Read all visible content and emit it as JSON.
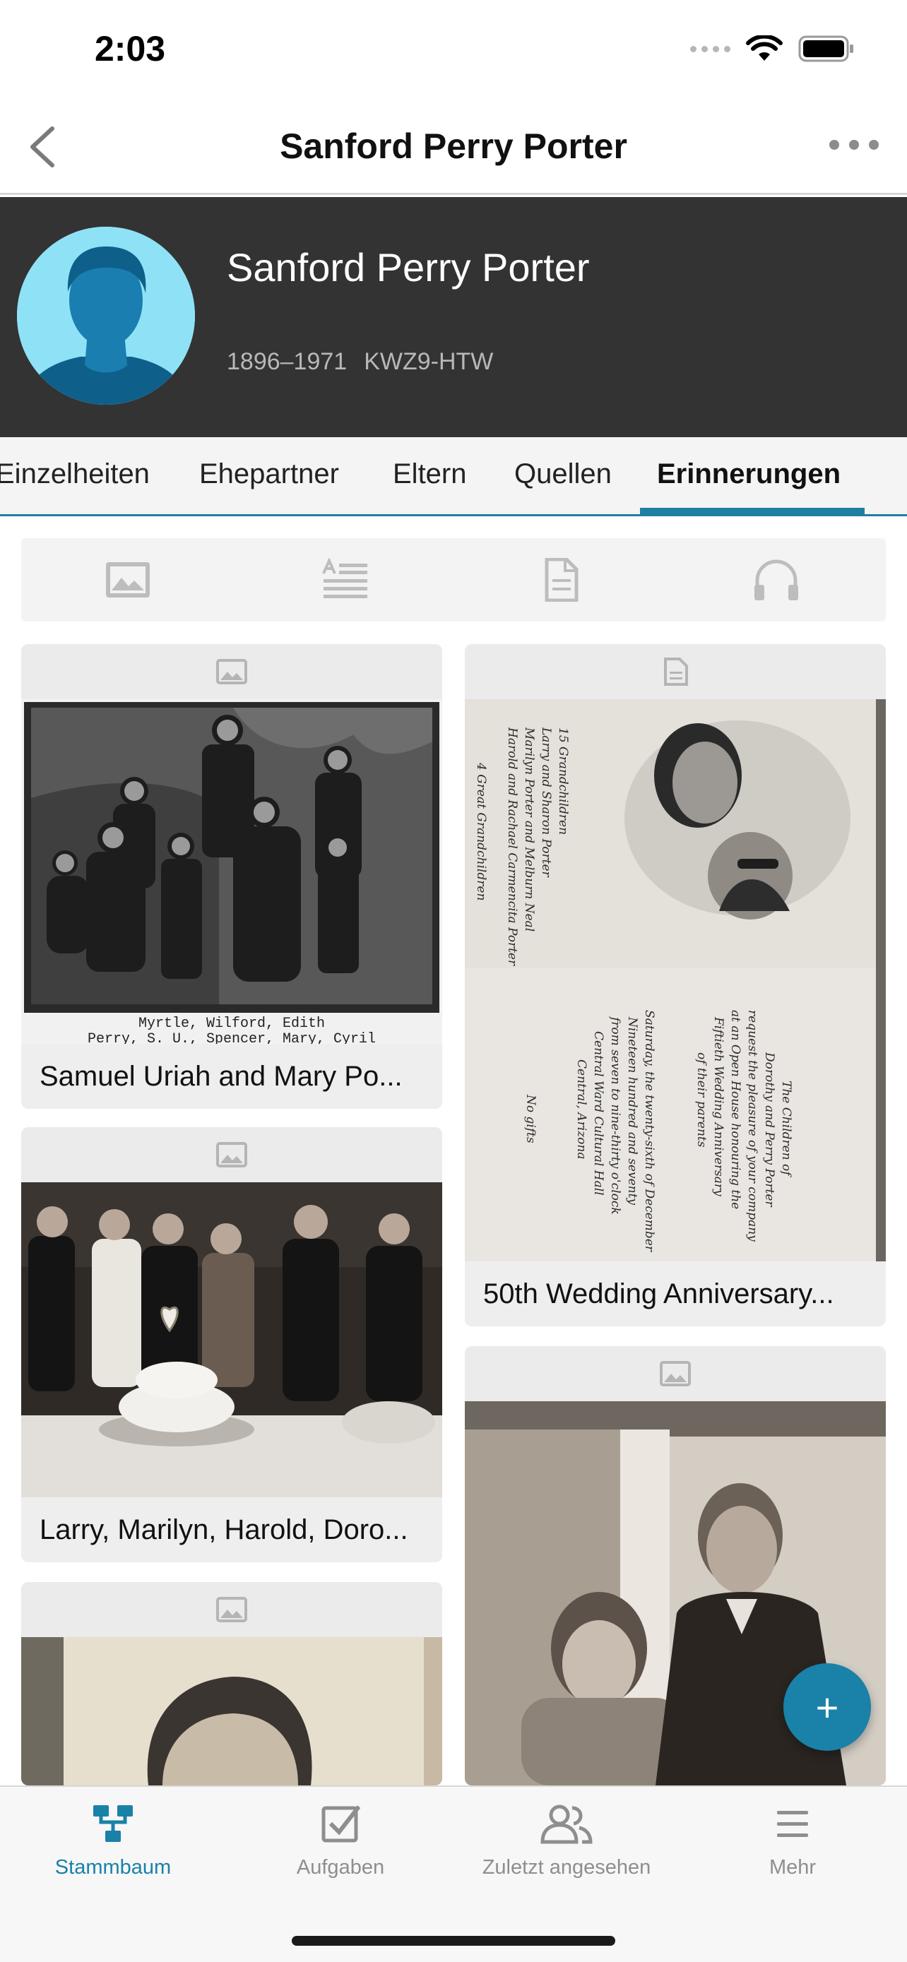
{
  "status_bar": {
    "time": "2:03"
  },
  "nav": {
    "title": "Sanford Perry Porter"
  },
  "person": {
    "name": "Sanford Perry Porter",
    "lifespan": "1896–1971",
    "id": "KWZ9-HTW"
  },
  "tabs": [
    {
      "label": "Einzelheiten"
    },
    {
      "label": "Ehepartner"
    },
    {
      "label": "Eltern"
    },
    {
      "label": "Quellen"
    },
    {
      "label": "Erinnerungen",
      "active": true
    }
  ],
  "filters": [
    {
      "icon": "photo-icon"
    },
    {
      "icon": "story-icon"
    },
    {
      "icon": "document-icon"
    },
    {
      "icon": "audio-icon"
    }
  ],
  "memories": [
    {
      "type_icon": "photo-icon",
      "caption": "Samuel Uriah and Mary Po...",
      "photo_text": [
        "Myrtle, Wilford, Edith",
        "Perry, S. U., Spencer, Mary, Cyril"
      ]
    },
    {
      "type_icon": "document-icon",
      "caption": "50th Wedding Anniversary...",
      "photo_text": [
        "Harold and Rachael Carmencita Porter",
        "Marilyn Porter and Melburn Neal",
        "Larry and Sharon Porter",
        "15 Grandchildren",
        "4 Great Grandchildren",
        "The Children of",
        "Dorothy and Perry Porter",
        "request the pleasure of your company",
        "at an Open House honouring the",
        "Fiftieth Wedding Anniversary",
        "of their parents",
        "Saturday, the twenty-sixth of December",
        "Nineteen hundred and seventy",
        "from seven to nine-thirty o'clock",
        "Central Ward Cultural Hall",
        "Central, Arizona",
        "No gifts"
      ]
    },
    {
      "type_icon": "photo-icon",
      "caption": "Larry, Marilyn, Harold, Doro..."
    },
    {
      "type_icon": "photo-icon",
      "caption": ""
    },
    {
      "type_icon": "photo-icon",
      "caption": ""
    }
  ],
  "fab": {
    "label": "+"
  },
  "bottom_nav": [
    {
      "label": "Stammbaum",
      "icon": "tree-icon",
      "active": true
    },
    {
      "label": "Aufgaben",
      "icon": "tasks-icon"
    },
    {
      "label": "Zuletzt angesehen",
      "icon": "recent-people-icon"
    },
    {
      "label": "Mehr",
      "icon": "menu-icon"
    }
  ],
  "colors": {
    "accent": "#1a81a8",
    "header_bg": "#333333",
    "avatar_bg": "#8fe2f6"
  }
}
